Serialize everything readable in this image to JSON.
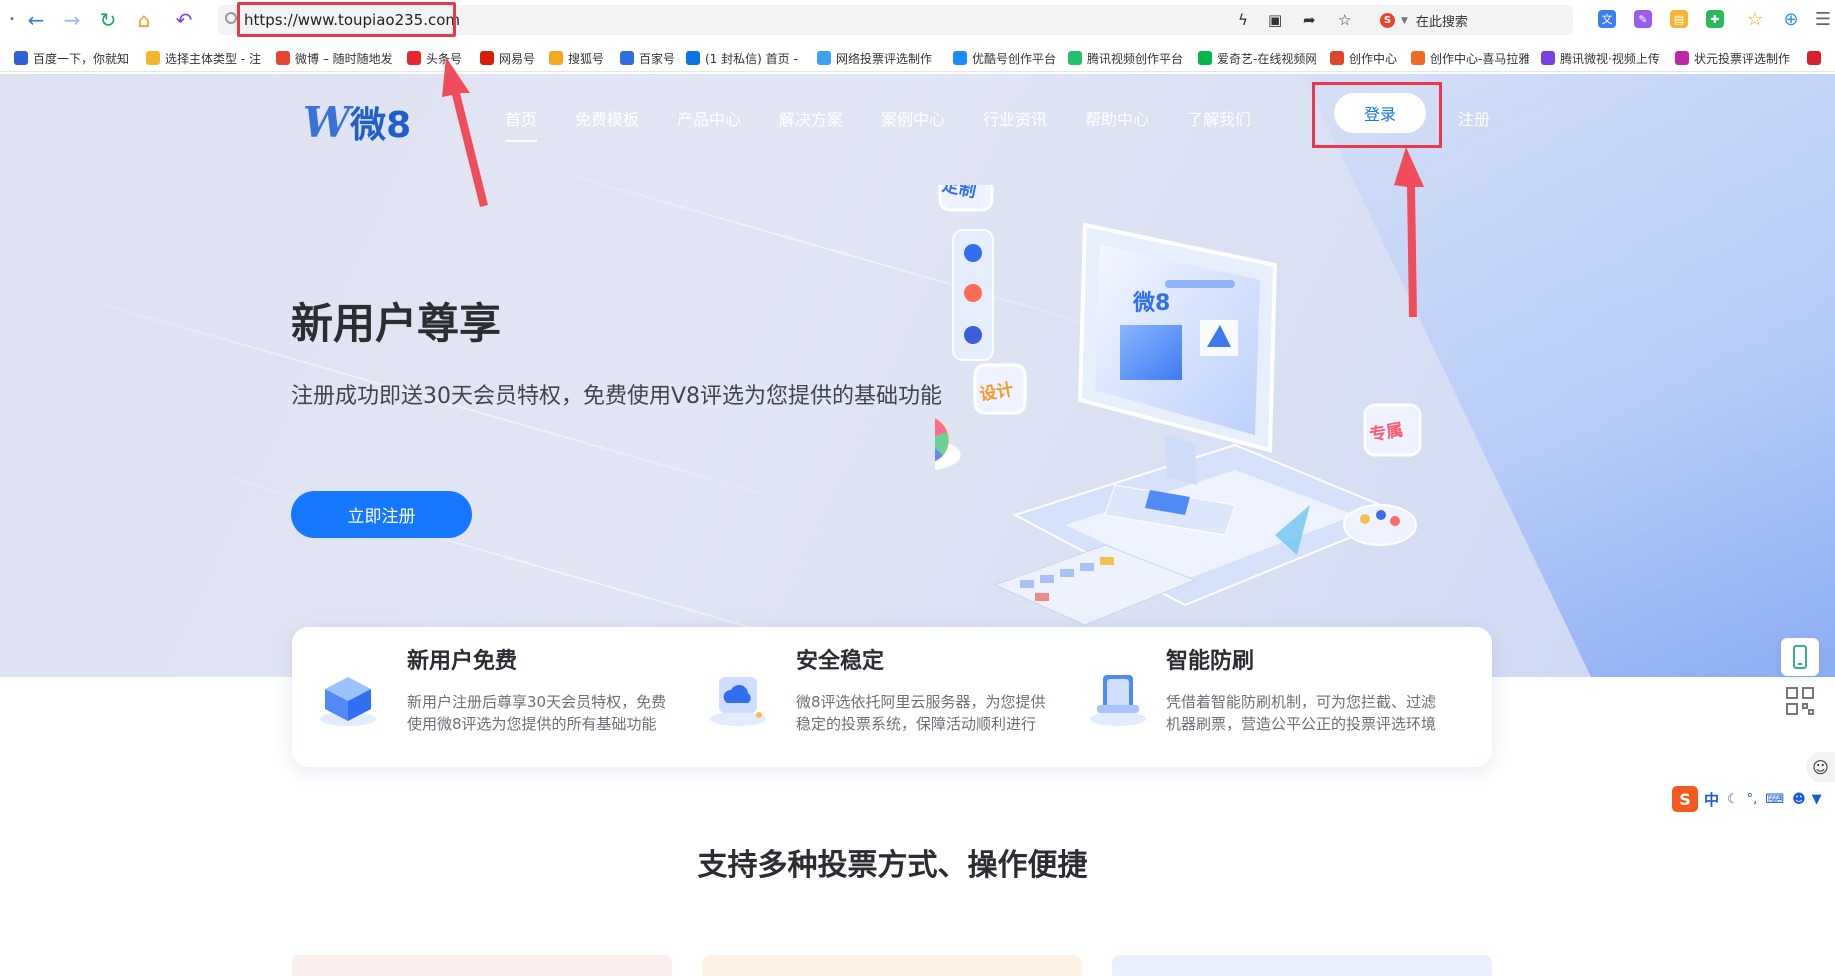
{
  "browser": {
    "url": "https://www.toupiao235.com",
    "search_engine_label": "在此搜索",
    "bookmarks": [
      {
        "label": "百度一下，你就知",
        "color": "#2f5fd8"
      },
      {
        "label": "选择主体类型 - 注",
        "color": "#f3b52a"
      },
      {
        "label": "微博 – 随时随地发",
        "color": "#e6442e"
      },
      {
        "label": "头条号",
        "color": "#e8262d"
      },
      {
        "label": "网易号",
        "color": "#d81e06"
      },
      {
        "label": "搜狐号",
        "color": "#f5a623"
      },
      {
        "label": "百家号",
        "color": "#2f6fe0"
      },
      {
        "label": "(1 封私信) 首页 -",
        "color": "#0b74e6"
      },
      {
        "label": "网络投票评选制作",
        "color": "#3aa0f0"
      },
      {
        "label": "优酷号创作平台",
        "color": "#1a8cff"
      },
      {
        "label": "腾讯视频创作平台",
        "color": "#23c16b"
      },
      {
        "label": "爱奇艺-在线视频网",
        "color": "#00b84a"
      },
      {
        "label": "创作中心",
        "color": "#e0452c"
      },
      {
        "label": "创作中心-喜马拉雅",
        "color": "#f06a23"
      },
      {
        "label": "腾讯微视·视频上传",
        "color": "#7b3fe4"
      },
      {
        "label": "状元投票评选制作",
        "color": "#c126a8"
      },
      {
        "label": "",
        "color": "#d8202a"
      }
    ]
  },
  "site": {
    "logo_text": "微8",
    "nav": [
      "首页",
      "免费模板",
      "产品中心",
      "解决方案",
      "案例中心",
      "行业资讯",
      "帮助中心",
      "了解我们"
    ],
    "login_label": "登录",
    "register_label": "注册"
  },
  "hero": {
    "title": "新用户尊享",
    "subtitle": "注册成功即送30天会员特权，免费使用V8评选为您提供的基础功能",
    "cta_label": "立即注册",
    "badges": {
      "custom": "定制",
      "design": "设计",
      "exclusive": "专属"
    },
    "screen_logo": "微8"
  },
  "features": [
    {
      "title": "新用户免费",
      "desc": "新用户注册后尊享30天会员特权，免费使用微8评选为您提供的所有基础功能"
    },
    {
      "title": "安全稳定",
      "desc": "微8评选依托阿里云服务器，为您提供稳定的投票系统，保障活动顺利进行"
    },
    {
      "title": "智能防刷",
      "desc": "凭借着智能防刷机制，可为您拦截、过滤机器刷票，营造公平公正的投票评选环境"
    }
  ],
  "section_title": "支持多种投票方式、操作便捷",
  "ime": {
    "label": "中"
  },
  "colors": {
    "primary": "#1677ff",
    "annotation_red": "#e8394b"
  }
}
